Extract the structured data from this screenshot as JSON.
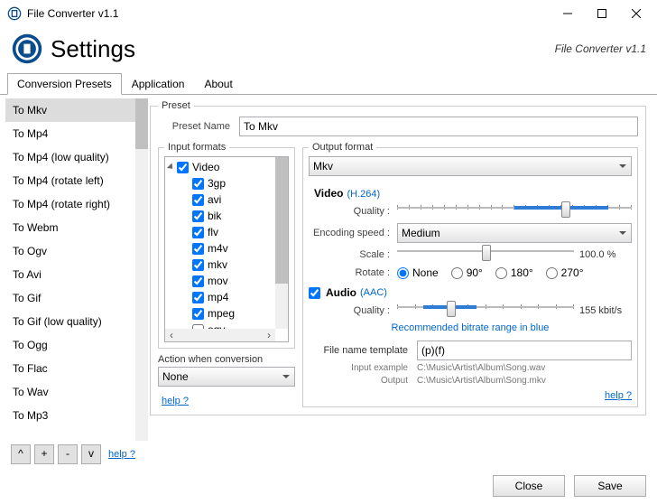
{
  "window": {
    "title": "File Converter v1.1"
  },
  "header": {
    "title": "Settings",
    "version": "File Converter v1.1"
  },
  "tabs": {
    "t0": "Conversion Presets",
    "t1": "Application",
    "t2": "About"
  },
  "presets": [
    "To Mkv",
    "To Mp4",
    "To Mp4 (low quality)",
    "To Mp4 (rotate left)",
    "To Mp4 (rotate right)",
    "To Webm",
    "To Ogv",
    "To Avi",
    "To Gif",
    "To Gif (low quality)",
    "To Ogg",
    "To Flac",
    "To Wav",
    "To Mp3"
  ],
  "leftBtns": {
    "up": "^",
    "add": "+",
    "del": "-",
    "down": "v"
  },
  "help": "help ?",
  "group": {
    "preset": "Preset",
    "input_formats": "Input formats",
    "output_format": "Output format"
  },
  "labels": {
    "preset_name": "Preset Name",
    "action": "Action when conversion",
    "quality": "Quality :",
    "encoding_speed": "Encoding speed :",
    "scale": "Scale :",
    "rotate": "Rotate :",
    "file_name_template": "File name template",
    "input_example": "Input example",
    "output_example": "Output"
  },
  "preset_name": "To Mkv",
  "tree": {
    "root": "Video",
    "items": [
      "3gp",
      "avi",
      "bik",
      "flv",
      "m4v",
      "mkv",
      "mov",
      "mp4",
      "mpeg",
      "ogv"
    ]
  },
  "action_value": "None",
  "output_format": "Mkv",
  "video_label": "Video",
  "video_codec": "(H.264)",
  "encoding_speed": "Medium",
  "scale_value": "100.0 %",
  "rotate": {
    "none": "None",
    "r90": "90°",
    "r180": "180°",
    "r270": "270°"
  },
  "audio_label": "Audio",
  "audio_codec": "(AAC)",
  "audio_quality_value": "155 kbit/s",
  "blue_note": "Recommended bitrate range in blue",
  "fn_template": "(p)(f)",
  "fn_input": "C:\\Music\\Artist\\Album\\Song.wav",
  "fn_output": "C:\\Music\\Artist\\Album\\Song.mkv",
  "footer": {
    "close": "Close",
    "save": "Save"
  }
}
